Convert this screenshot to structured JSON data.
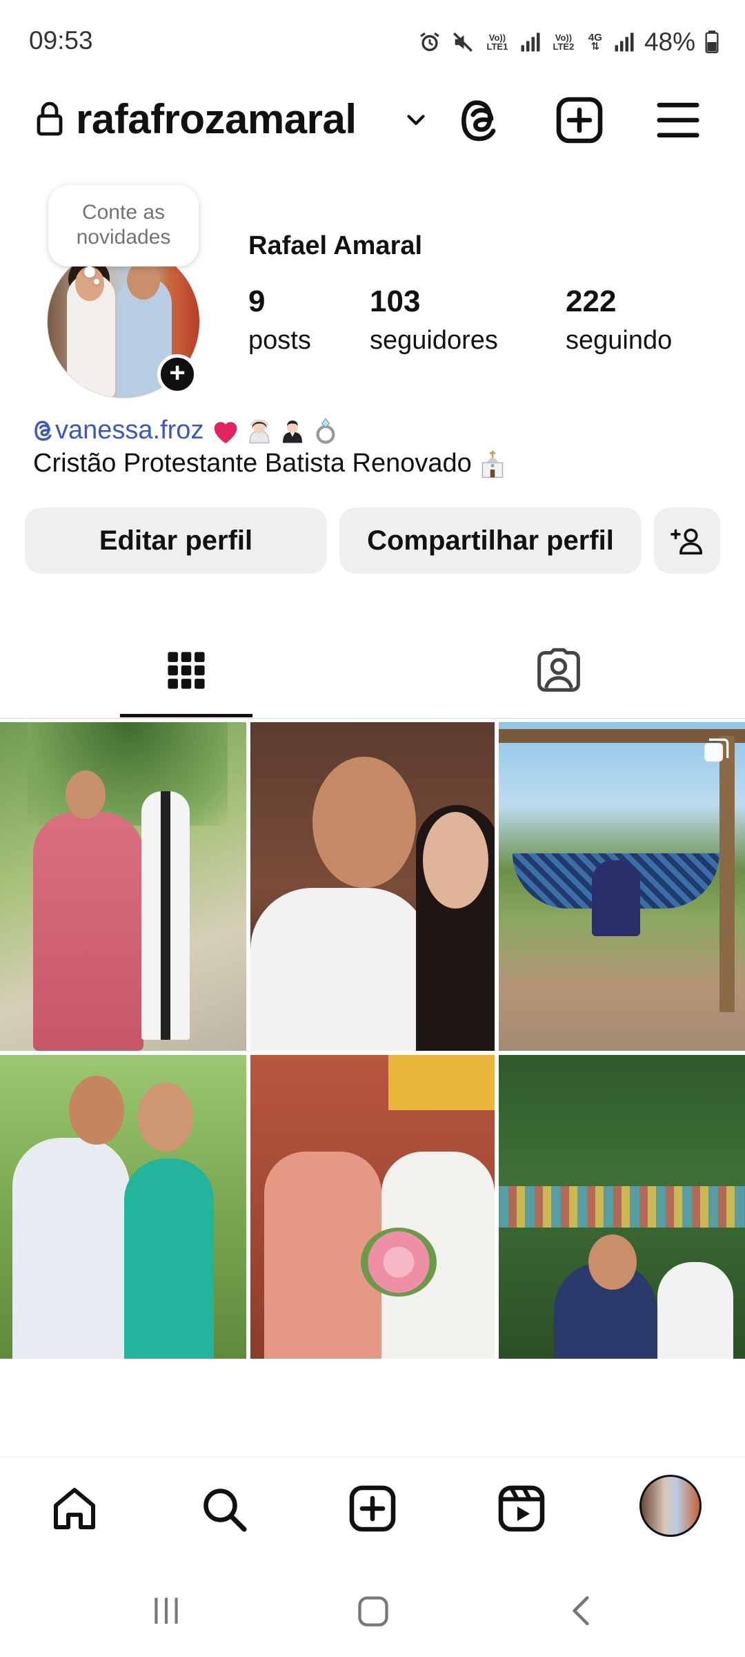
{
  "status": {
    "time": "09:53",
    "battery": "48%",
    "sim1_label": "Vo)) LTE1",
    "sim2_label": "Vo)) LTE2",
    "network": "4G"
  },
  "header": {
    "username": "rafafrozamaral"
  },
  "profile": {
    "note": "Conte as novidades",
    "full_name": "Rafael Amaral",
    "stats": [
      {
        "value": "9",
        "label": "posts"
      },
      {
        "value": "103",
        "label": "seguidores"
      },
      {
        "value": "222",
        "label": "seguindo"
      }
    ],
    "bio_mention": "vanessa.froz",
    "bio_emojis": [
      "❤️",
      "👰🏻",
      "🤵🏻",
      "💍"
    ],
    "bio_text": "Cristão Protestante Batista Renovado",
    "bio_emoji_end": "⛪"
  },
  "buttons": {
    "edit": "Editar perfil",
    "share": "Compartilhar perfil"
  },
  "tabs": [
    "grid-icon",
    "tagged-icon"
  ],
  "colors": {
    "mention": "#3a56c9",
    "button_bg": "#efefef",
    "heart": "#e0245e"
  }
}
